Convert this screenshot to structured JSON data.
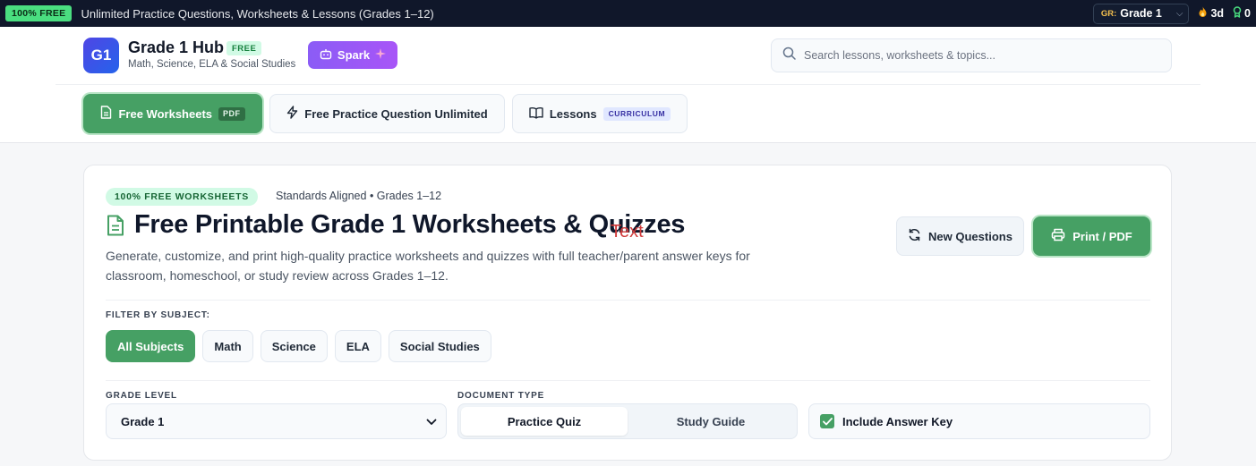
{
  "topbar": {
    "badge": "100% FREE",
    "message": "Unlimited Practice Questions, Worksheets & Lessons (Grades 1–12)",
    "grade_prefix": "GR:",
    "grade_value": "Grade 1",
    "streak": "3d",
    "awards": "0"
  },
  "header": {
    "logo_text": "G1",
    "title": "Grade 1 Hub",
    "free_badge": "FREE",
    "subtitle": "Math, Science, ELA & Social Studies",
    "spark_label": "Spark",
    "search_placeholder": "Search lessons, worksheets & topics..."
  },
  "tabs": [
    {
      "label": "Free Worksheets",
      "badge": "PDF"
    },
    {
      "label": "Free Practice Question Unlimited"
    },
    {
      "label": "Lessons",
      "badge": "CURRICULUM"
    }
  ],
  "card": {
    "badge": "100% FREE WORKSHEETS",
    "meta": "Standards Aligned • Grades 1–12",
    "title": "Free Printable Grade 1 Worksheets & Quizzes",
    "overlay_text": "Text",
    "description": "Generate, customize, and print high-quality practice worksheets and quizzes with full teacher/parent answer keys for classroom, homeschool, or study review across Grades 1–12.",
    "new_questions_label": "New Questions",
    "print_label": "Print / PDF",
    "filter_label": "FILTER BY SUBJECT:",
    "subjects": [
      "All Subjects",
      "Math",
      "Science",
      "ELA",
      "Social Studies"
    ],
    "grade_level_label": "GRADE LEVEL",
    "grade_level_value": "Grade 1",
    "doc_type_label": "DOCUMENT TYPE",
    "doc_types": [
      "Practice Quiz",
      "Study Guide"
    ],
    "answer_key_label": "Include Answer Key"
  },
  "colors": {
    "accent_green": "#46a064",
    "topbar_bg": "#10172a",
    "spark_purple": "#8b5cf6",
    "logo_blue": "#4f46e5"
  }
}
